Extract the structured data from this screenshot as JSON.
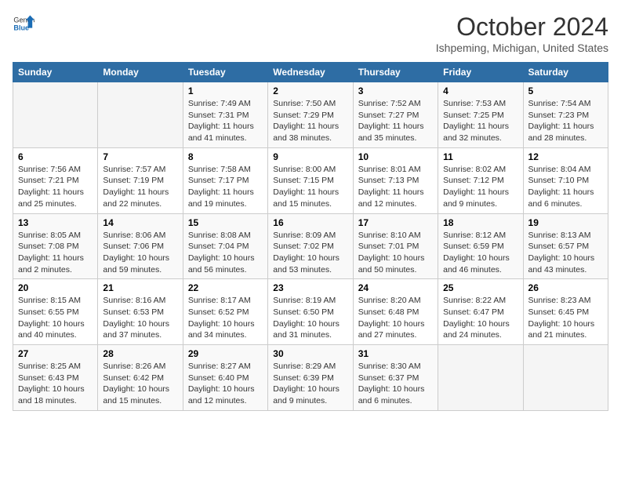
{
  "header": {
    "logo_general": "General",
    "logo_blue": "Blue",
    "title": "October 2024",
    "subtitle": "Ishpeming, Michigan, United States"
  },
  "days_of_week": [
    "Sunday",
    "Monday",
    "Tuesday",
    "Wednesday",
    "Thursday",
    "Friday",
    "Saturday"
  ],
  "weeks": [
    [
      {
        "day": "",
        "info": ""
      },
      {
        "day": "",
        "info": ""
      },
      {
        "day": "1",
        "info": "Sunrise: 7:49 AM\nSunset: 7:31 PM\nDaylight: 11 hours and 41 minutes."
      },
      {
        "day": "2",
        "info": "Sunrise: 7:50 AM\nSunset: 7:29 PM\nDaylight: 11 hours and 38 minutes."
      },
      {
        "day": "3",
        "info": "Sunrise: 7:52 AM\nSunset: 7:27 PM\nDaylight: 11 hours and 35 minutes."
      },
      {
        "day": "4",
        "info": "Sunrise: 7:53 AM\nSunset: 7:25 PM\nDaylight: 11 hours and 32 minutes."
      },
      {
        "day": "5",
        "info": "Sunrise: 7:54 AM\nSunset: 7:23 PM\nDaylight: 11 hours and 28 minutes."
      }
    ],
    [
      {
        "day": "6",
        "info": "Sunrise: 7:56 AM\nSunset: 7:21 PM\nDaylight: 11 hours and 25 minutes."
      },
      {
        "day": "7",
        "info": "Sunrise: 7:57 AM\nSunset: 7:19 PM\nDaylight: 11 hours and 22 minutes."
      },
      {
        "day": "8",
        "info": "Sunrise: 7:58 AM\nSunset: 7:17 PM\nDaylight: 11 hours and 19 minutes."
      },
      {
        "day": "9",
        "info": "Sunrise: 8:00 AM\nSunset: 7:15 PM\nDaylight: 11 hours and 15 minutes."
      },
      {
        "day": "10",
        "info": "Sunrise: 8:01 AM\nSunset: 7:13 PM\nDaylight: 11 hours and 12 minutes."
      },
      {
        "day": "11",
        "info": "Sunrise: 8:02 AM\nSunset: 7:12 PM\nDaylight: 11 hours and 9 minutes."
      },
      {
        "day": "12",
        "info": "Sunrise: 8:04 AM\nSunset: 7:10 PM\nDaylight: 11 hours and 6 minutes."
      }
    ],
    [
      {
        "day": "13",
        "info": "Sunrise: 8:05 AM\nSunset: 7:08 PM\nDaylight: 11 hours and 2 minutes."
      },
      {
        "day": "14",
        "info": "Sunrise: 8:06 AM\nSunset: 7:06 PM\nDaylight: 10 hours and 59 minutes."
      },
      {
        "day": "15",
        "info": "Sunrise: 8:08 AM\nSunset: 7:04 PM\nDaylight: 10 hours and 56 minutes."
      },
      {
        "day": "16",
        "info": "Sunrise: 8:09 AM\nSunset: 7:02 PM\nDaylight: 10 hours and 53 minutes."
      },
      {
        "day": "17",
        "info": "Sunrise: 8:10 AM\nSunset: 7:01 PM\nDaylight: 10 hours and 50 minutes."
      },
      {
        "day": "18",
        "info": "Sunrise: 8:12 AM\nSunset: 6:59 PM\nDaylight: 10 hours and 46 minutes."
      },
      {
        "day": "19",
        "info": "Sunrise: 8:13 AM\nSunset: 6:57 PM\nDaylight: 10 hours and 43 minutes."
      }
    ],
    [
      {
        "day": "20",
        "info": "Sunrise: 8:15 AM\nSunset: 6:55 PM\nDaylight: 10 hours and 40 minutes."
      },
      {
        "day": "21",
        "info": "Sunrise: 8:16 AM\nSunset: 6:53 PM\nDaylight: 10 hours and 37 minutes."
      },
      {
        "day": "22",
        "info": "Sunrise: 8:17 AM\nSunset: 6:52 PM\nDaylight: 10 hours and 34 minutes."
      },
      {
        "day": "23",
        "info": "Sunrise: 8:19 AM\nSunset: 6:50 PM\nDaylight: 10 hours and 31 minutes."
      },
      {
        "day": "24",
        "info": "Sunrise: 8:20 AM\nSunset: 6:48 PM\nDaylight: 10 hours and 27 minutes."
      },
      {
        "day": "25",
        "info": "Sunrise: 8:22 AM\nSunset: 6:47 PM\nDaylight: 10 hours and 24 minutes."
      },
      {
        "day": "26",
        "info": "Sunrise: 8:23 AM\nSunset: 6:45 PM\nDaylight: 10 hours and 21 minutes."
      }
    ],
    [
      {
        "day": "27",
        "info": "Sunrise: 8:25 AM\nSunset: 6:43 PM\nDaylight: 10 hours and 18 minutes."
      },
      {
        "day": "28",
        "info": "Sunrise: 8:26 AM\nSunset: 6:42 PM\nDaylight: 10 hours and 15 minutes."
      },
      {
        "day": "29",
        "info": "Sunrise: 8:27 AM\nSunset: 6:40 PM\nDaylight: 10 hours and 12 minutes."
      },
      {
        "day": "30",
        "info": "Sunrise: 8:29 AM\nSunset: 6:39 PM\nDaylight: 10 hours and 9 minutes."
      },
      {
        "day": "31",
        "info": "Sunrise: 8:30 AM\nSunset: 6:37 PM\nDaylight: 10 hours and 6 minutes."
      },
      {
        "day": "",
        "info": ""
      },
      {
        "day": "",
        "info": ""
      }
    ]
  ]
}
